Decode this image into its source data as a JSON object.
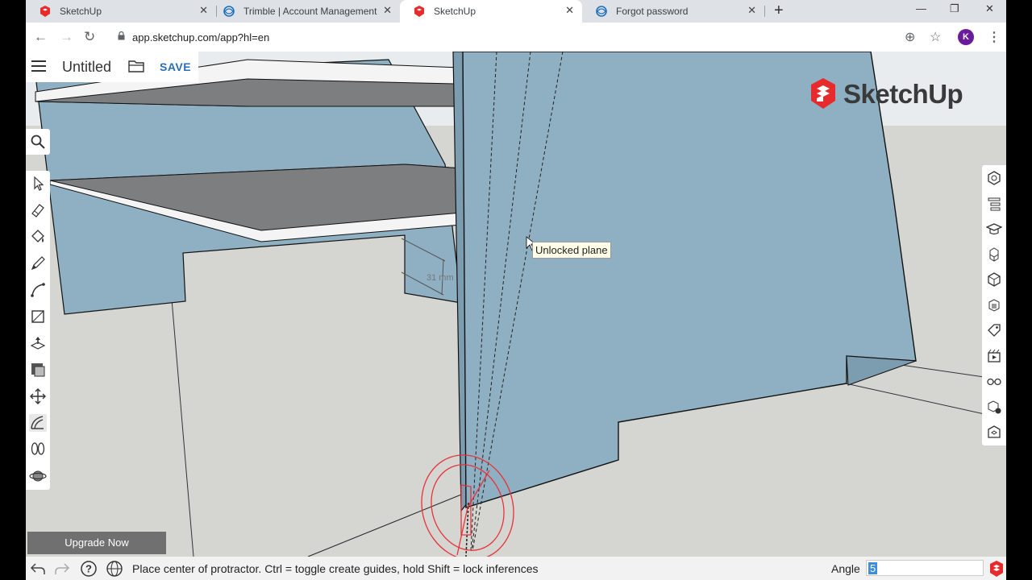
{
  "browser": {
    "tabs": [
      {
        "title": "SketchUp",
        "active": false
      },
      {
        "title": "Trimble | Account Management",
        "active": false
      },
      {
        "title": "SketchUp",
        "active": true
      },
      {
        "title": "Forgot password",
        "active": false
      }
    ],
    "new_tab": "+",
    "url": "app.sketchup.com/app?hl=en",
    "profile_initial": "K",
    "window_controls": {
      "minimize": "—",
      "restore": "❐",
      "close": "✕"
    }
  },
  "app": {
    "title": "Untitled",
    "save_label": "SAVE",
    "logo_text": "SketchUp",
    "upgrade_label": "Upgrade Now",
    "tooltip": "Unlocked plane",
    "dimension_label": "31 mm",
    "left_tools": [
      "select-icon",
      "eraser-icon",
      "paint-bucket-icon",
      "pencil-icon",
      "arc-icon",
      "rectangle-icon",
      "push-pull-icon",
      "offset-icon",
      "move-icon",
      "protractor-icon",
      "tape-measure-icon",
      "orbit-icon"
    ],
    "selected_tool": "protractor-icon",
    "right_tools": [
      "entity-info-icon",
      "outliner-icon",
      "instructor-icon",
      "components-icon",
      "materials-icon",
      "styles-icon",
      "tags-icon",
      "scenes-icon",
      "display-icon",
      "solid-inspector-icon",
      "3d-warehouse-icon"
    ]
  },
  "status_bar": {
    "text": "Place center of protractor. Ctrl = toggle create guides, hold Shift = lock inferences",
    "vcb_label": "Angle",
    "vcb_value": "5"
  },
  "colors": {
    "panel_blue": "#8fb0c3",
    "shelf_top": "#7d7e80",
    "protractor_red": "#e8323a",
    "brand_red": "#e72b2d",
    "save_blue": "#2a6eb5"
  }
}
